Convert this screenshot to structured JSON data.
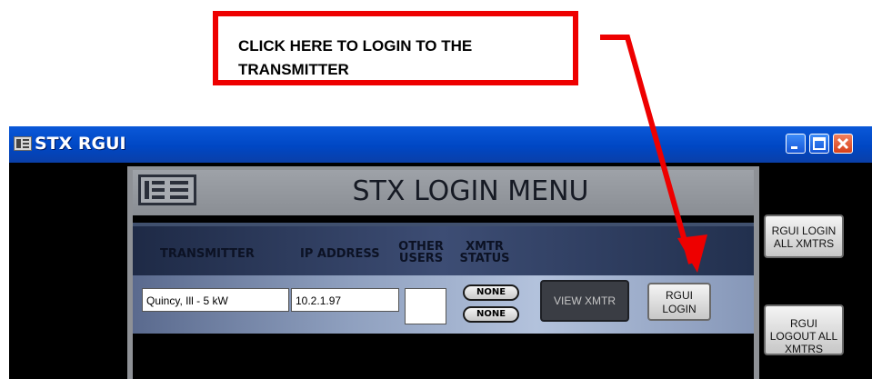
{
  "callout": {
    "text": "CLICK HERE TO LOGIN TO THE TRANSMITTER"
  },
  "window": {
    "title": "STX RGUI"
  },
  "panel": {
    "title": "STX LOGIN MENU",
    "logo": "BE-logo"
  },
  "columns": {
    "transmitter": "TRANSMITTER",
    "ip_address": "IP ADDRESS",
    "other_users": "OTHER USERS",
    "xmtr_status": "XMTR STATUS"
  },
  "row": {
    "transmitter": "Quincy, Ill - 5 kW",
    "ip_address": "10.2.1.97",
    "other_users": "",
    "status_1": "NONE",
    "status_2": "NONE",
    "view_button": "VIEW XMTR",
    "login_button": "RGUI LOGIN"
  },
  "side": {
    "login_all": "RGUI LOGIN ALL XMTRS",
    "logout_all": "RGUI LOGOUT ALL XMTRS"
  },
  "colors": {
    "callout": "#ee0000",
    "titlebar": "#0047c4"
  }
}
